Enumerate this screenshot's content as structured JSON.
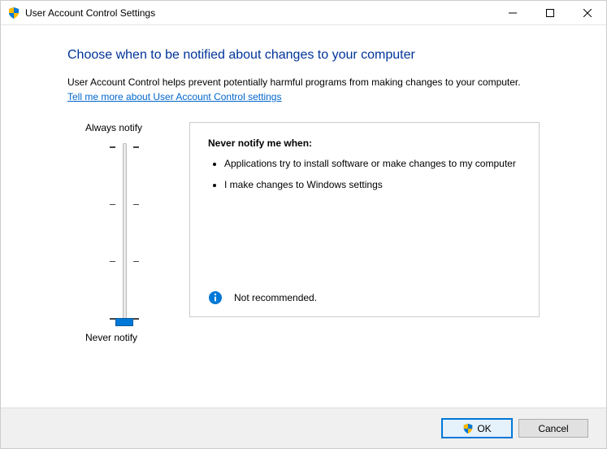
{
  "window": {
    "title": "User Account Control Settings"
  },
  "heading": "Choose when to be notified about changes to your computer",
  "description": "User Account Control helps prevent potentially harmful programs from making changes to your computer.",
  "link_text": "Tell me more about User Account Control settings",
  "slider": {
    "top_label": "Always notify",
    "bottom_label": "Never notify",
    "levels": 4,
    "current_level_index": 3
  },
  "panel": {
    "title": "Never notify me when:",
    "bullets": [
      "Applications try to install software or make changes to my computer",
      "I make changes to Windows settings"
    ],
    "footer_text": "Not recommended."
  },
  "buttons": {
    "ok": "OK",
    "cancel": "Cancel"
  }
}
